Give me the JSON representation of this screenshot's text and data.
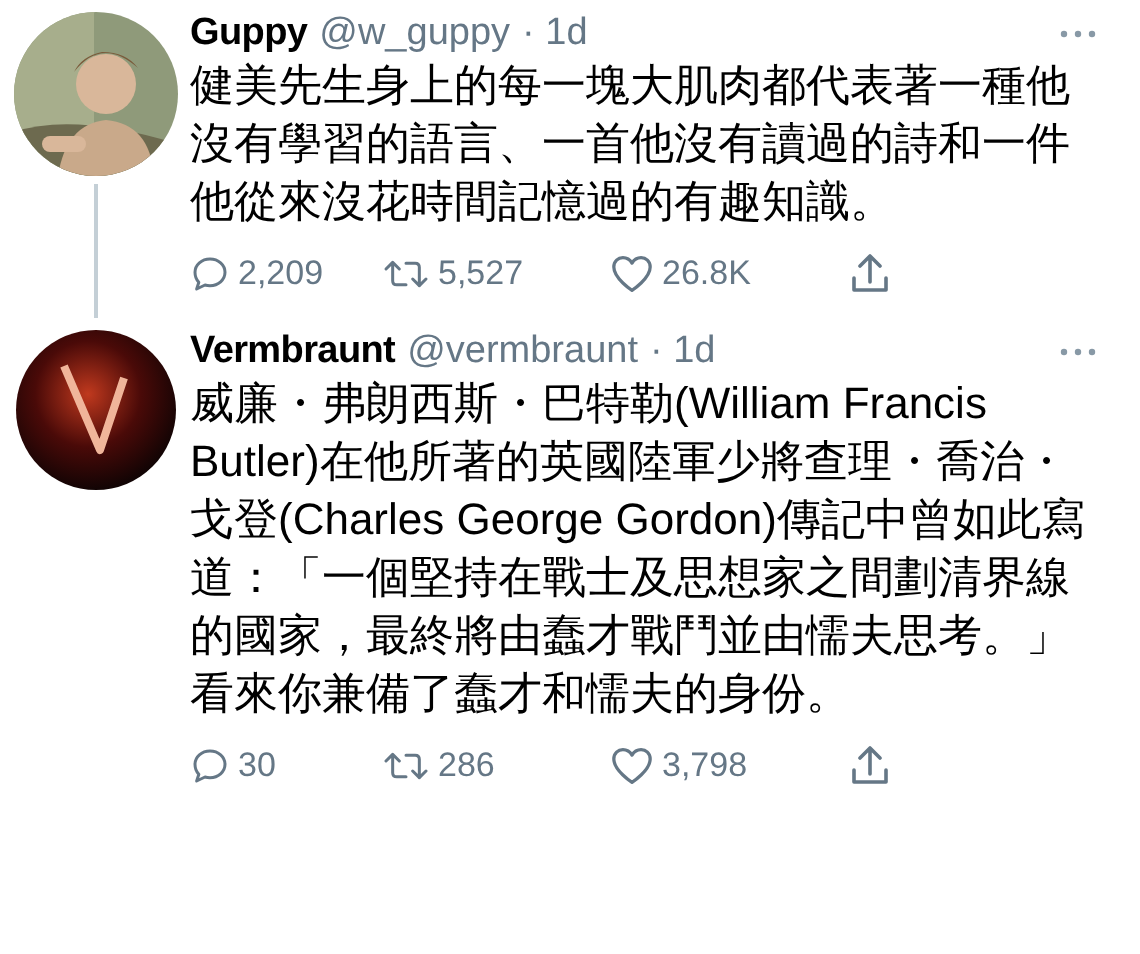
{
  "tweets": [
    {
      "name": "Guppy",
      "handle": "@w_guppy",
      "time": "· 1d",
      "thread_line": true,
      "text": "健美先生身上的每一塊大肌肉都代表著一種他沒有學習的語言、一首他沒有讀過的詩和一件他從來沒花時間記憶過的有趣知識。",
      "replies": "2,209",
      "retweets": "5,527",
      "likes": "26.8K"
    },
    {
      "name": "Vermbraunt",
      "handle": "@vermbraunt",
      "time": "· 1d",
      "thread_line": false,
      "text": "威廉・弗朗西斯・巴特勒(William Francis Butler)在他所著的英國陸軍少將查理・喬治・戈登(Charles George Gordon)傳記中曾如此寫道：「一個堅持在戰士及思想家之間劃清界線的國家，最終將由蠢才戰鬥並由懦夫思考。」看來你兼備了蠢才和懦夫的身份。",
      "replies": "30",
      "retweets": "286",
      "likes": "3,798"
    }
  ]
}
